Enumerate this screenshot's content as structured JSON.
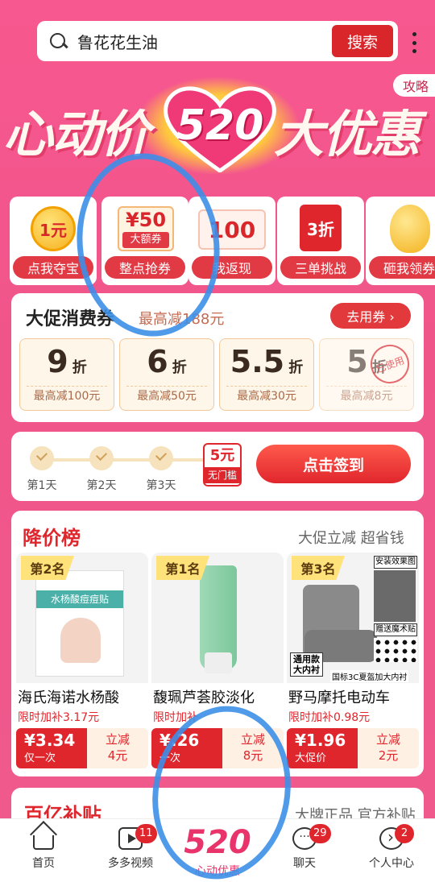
{
  "search": {
    "query": "鲁花花生油",
    "button": "搜索"
  },
  "banner": {
    "left_text": "心动价",
    "heart_text": "520",
    "right_text": "大优惠",
    "corner_tag": "攻略"
  },
  "entries": [
    {
      "graphic": "1元",
      "label": "点我夺宝"
    },
    {
      "graphic": "¥50",
      "graphic_tag": "大额券",
      "label": "整点抢券"
    },
    {
      "graphic": "100",
      "label": "我返现"
    },
    {
      "graphic": "3折",
      "label": "三单挑战"
    },
    {
      "graphic": "",
      "label": "砸我领券"
    }
  ],
  "promo": {
    "title": "大促消费券",
    "subtitle": "最高减188元",
    "button": "去用券 ›",
    "coupons": [
      {
        "value": "9",
        "unit": "折",
        "note": "最高减100元"
      },
      {
        "value": "6",
        "unit": "折",
        "note": "最高减50元"
      },
      {
        "value": "5.5",
        "unit": "折",
        "note": "最高减30元"
      },
      {
        "value": "5",
        "unit": "折",
        "note": "最高减8元",
        "stamp": "已使用"
      }
    ]
  },
  "checkin": {
    "days": [
      "第1天",
      "第2天",
      "第3天"
    ],
    "reward_value": "5元",
    "reward_tag": "无门槛",
    "button": "点击签到"
  },
  "price_drop": {
    "title": "降价榜",
    "subtitle": "大促立减 超省钱",
    "products": [
      {
        "rank": "第2名",
        "name": "海氏海诺水杨酸",
        "extra": "限时加补3.17元",
        "price": "¥3.34",
        "price_note": "仅一次",
        "cut": "立减",
        "cut_value": "4元",
        "box_band": "水杨酸痘痘贴"
      },
      {
        "rank": "第1名",
        "name": "馥珮芦荟胶淡化",
        "extra": "限时加补",
        "price": "¥.26",
        "price_note": "一次",
        "cut": "立减",
        "cut_value": "8元"
      },
      {
        "rank": "第3名",
        "name": "野马摩托电动车",
        "extra": "限时加补0.98元",
        "price": "¥1.96",
        "price_note": "大促价",
        "cut": "立减",
        "cut_value": "2元",
        "tag_top": "安装效果图",
        "tag_mid": "赠送魔术贴",
        "tag_bl": "通用款\n大内衬",
        "tag_br": "国标3C夏盔加大内衬"
      }
    ]
  },
  "next_section": {
    "title": "百亿补贴",
    "subtitle": "大牌正品 官方补贴"
  },
  "tabbar": [
    {
      "label": "首页",
      "icon": "home-icon"
    },
    {
      "label": "多多视频",
      "icon": "video-icon",
      "badge": "11"
    },
    {
      "label": "心动优惠",
      "icon": "520",
      "active": true
    },
    {
      "label": "聊天",
      "icon": "chat-icon",
      "badge": "29"
    },
    {
      "label": "个人中心",
      "icon": "user-icon",
      "badge": "2"
    }
  ],
  "colors": {
    "brand_red": "#e0262d",
    "pink_bg": "#f0558a",
    "accent_pink": "#e8336b",
    "scribble_blue": "#3d8fe8"
  }
}
